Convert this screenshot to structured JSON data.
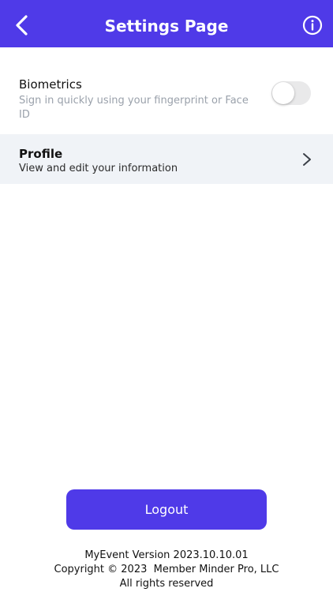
{
  "header": {
    "title": "Settings Page",
    "back_icon": "chevron-left-icon",
    "info_icon": "info-icon",
    "color": "#4f3ae8"
  },
  "settings": {
    "biometrics": {
      "title": "Biometrics",
      "subtitle": "Sign in quickly using your fingerprint or Face ID",
      "enabled": false
    },
    "profile": {
      "title": "Profile",
      "subtitle": "View and edit your information",
      "icon": "chevron-right-icon"
    }
  },
  "logout": {
    "label": "Logout"
  },
  "footer": {
    "version": "MyEvent Version 2023.10.10.01",
    "copyright": "Copyright © 2023  Member Minder Pro, LLC",
    "rights": "All rights reserved"
  }
}
